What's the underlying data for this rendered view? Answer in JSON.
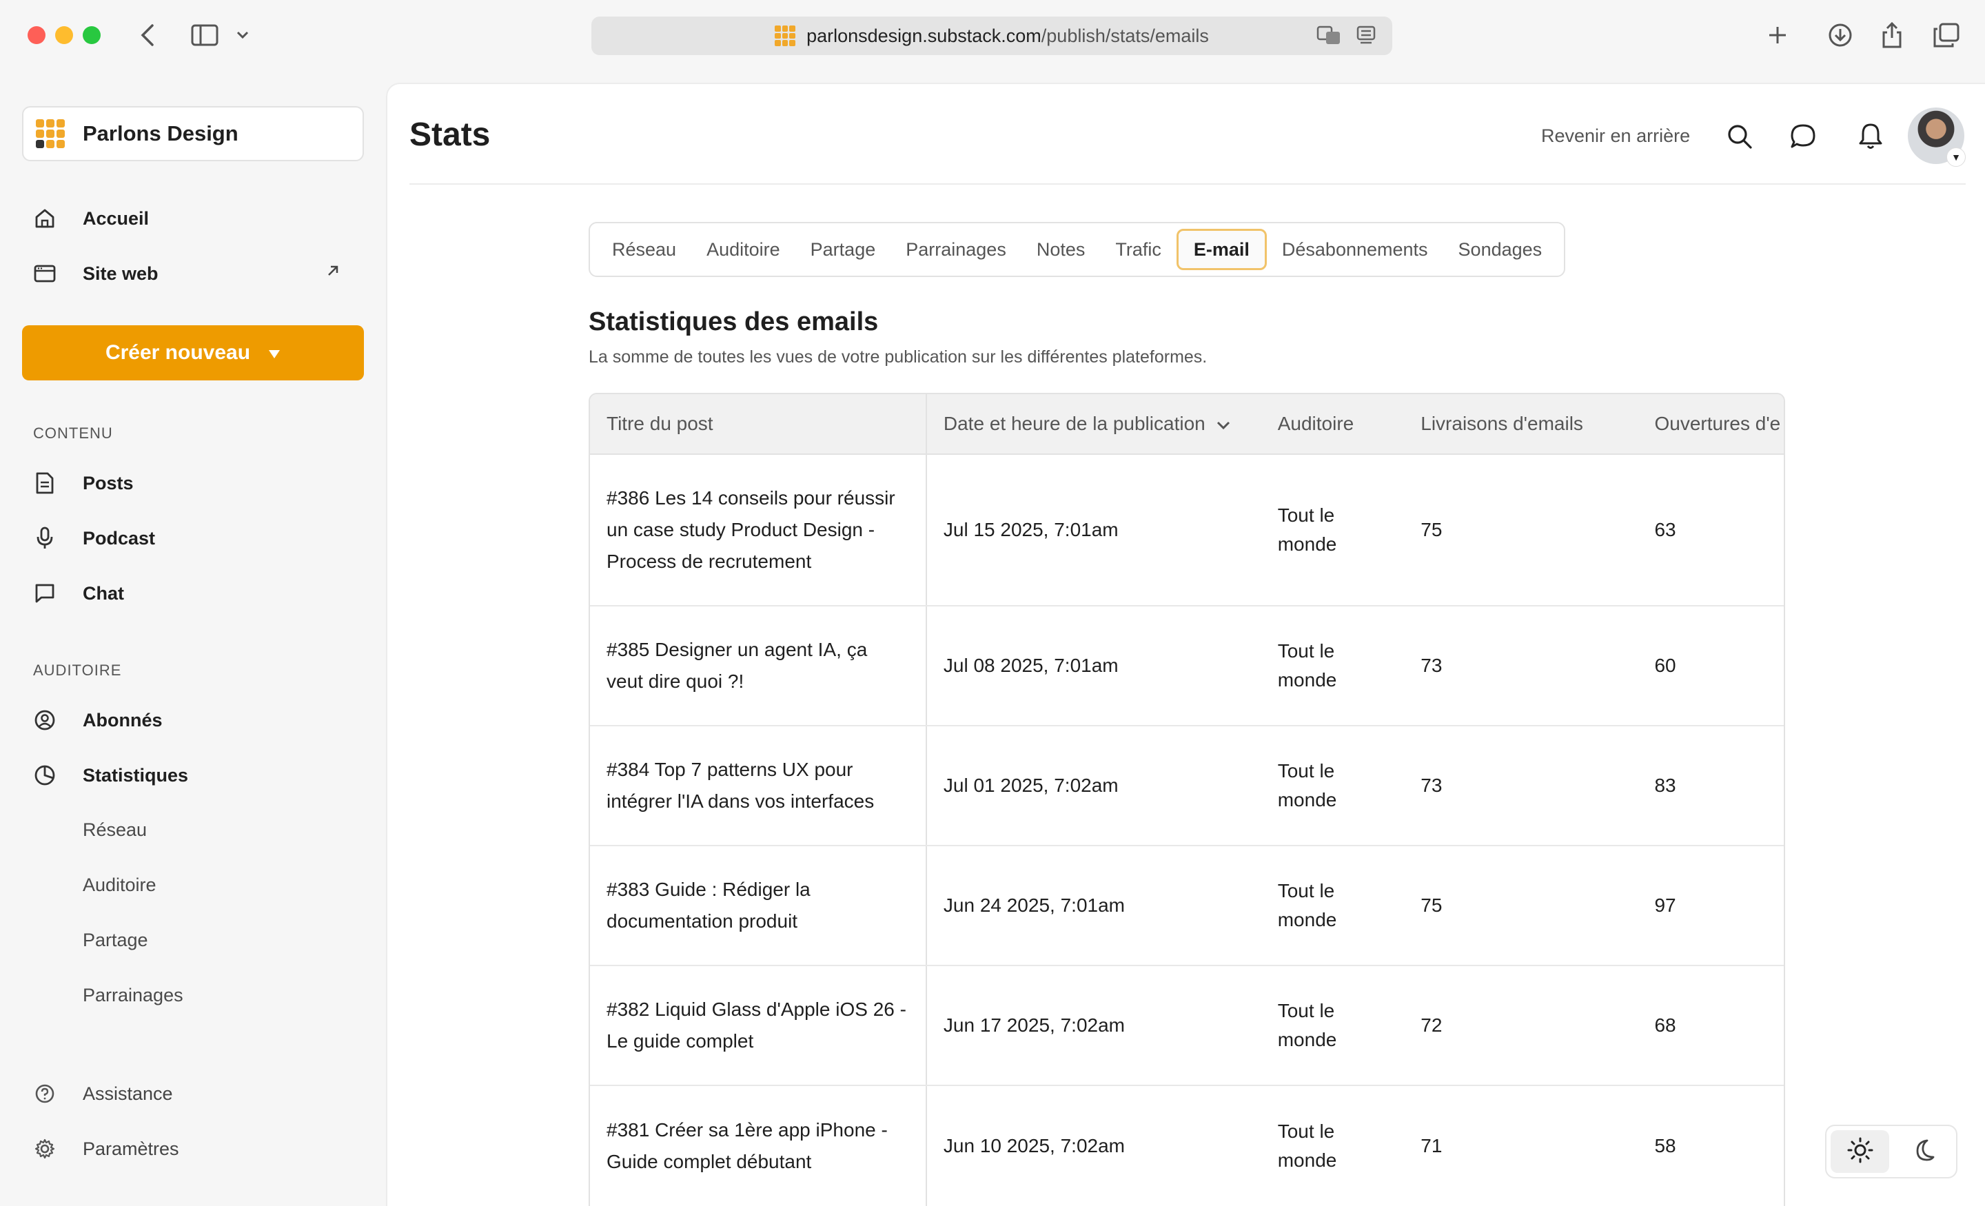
{
  "browser": {
    "url_domain": "parlonsdesign.substack.com",
    "url_path": "/publish/stats/emails"
  },
  "sidebar": {
    "publication_name": "Parlons Design",
    "top_items": [
      {
        "label": "Accueil",
        "icon": "home-icon"
      },
      {
        "label": "Site web",
        "icon": "browser-window-icon"
      }
    ],
    "create_label": "Créer nouveau",
    "content_label": "CONTENU",
    "content_items": [
      {
        "label": "Posts",
        "icon": "document-icon"
      },
      {
        "label": "Podcast",
        "icon": "microphone-icon"
      },
      {
        "label": "Chat",
        "icon": "chat-bubble-icon"
      }
    ],
    "audience_label": "AUDITOIRE",
    "audience_items": [
      {
        "label": "Abonnés",
        "icon": "user-circle-icon"
      },
      {
        "label": "Statistiques",
        "icon": "pie-chart-icon"
      }
    ],
    "stats_subitems": [
      "Réseau",
      "Auditoire",
      "Partage",
      "Parrainages"
    ],
    "bottom_items": [
      {
        "label": "Assistance",
        "icon": "help-icon"
      },
      {
        "label": "Paramètres",
        "icon": "gear-icon"
      }
    ]
  },
  "header": {
    "title": "Stats",
    "back_label": "Revenir en arrière"
  },
  "tabs": [
    "Réseau",
    "Auditoire",
    "Partage",
    "Parrainages",
    "Notes",
    "Trafic",
    "E-mail",
    "Désabonnements",
    "Sondages"
  ],
  "active_tab": "E-mail",
  "section": {
    "title": "Statistiques des emails",
    "subtitle": "La somme de toutes les vues de votre publication sur les différentes plateformes."
  },
  "table": {
    "columns": [
      "Titre du post",
      "Date et heure de la publication",
      "Auditoire",
      "Livraisons d'emails",
      "Ouvertures d'e"
    ],
    "rows": [
      {
        "title": [
          "#386 Les 14 conseils pour réussir",
          "un case study Product Design -",
          "Process de recrutement"
        ],
        "date": "Jul 15 2025, 7:01am",
        "audience": [
          "Tout le",
          "monde"
        ],
        "deliveries": "75",
        "opens": "63"
      },
      {
        "title": [
          "#385 Designer un agent IA, ça",
          "veut dire quoi ?!"
        ],
        "date": "Jul 08 2025, 7:01am",
        "audience": [
          "Tout le",
          "monde"
        ],
        "deliveries": "73",
        "opens": "60"
      },
      {
        "title": [
          "#384 Top 7 patterns UX pour",
          "intégrer l'IA dans vos interfaces"
        ],
        "date": "Jul 01 2025, 7:02am",
        "audience": [
          "Tout le",
          "monde"
        ],
        "deliveries": "73",
        "opens": "83"
      },
      {
        "title": [
          "#383 Guide : Rédiger la",
          "documentation produit"
        ],
        "date": "Jun 24 2025, 7:01am",
        "audience": [
          "Tout le",
          "monde"
        ],
        "deliveries": "75",
        "opens": "97"
      },
      {
        "title": [
          "#382 Liquid Glass d'Apple iOS 26 -",
          "Le guide complet"
        ],
        "date": "Jun 17 2025, 7:02am",
        "audience": [
          "Tout le",
          "monde"
        ],
        "deliveries": "72",
        "opens": "68"
      },
      {
        "title": [
          "#381 Créer sa 1ère app iPhone -",
          "Guide complet débutant"
        ],
        "date": "Jun 10 2025, 7:02am",
        "audience": [
          "Tout le",
          "monde"
        ],
        "deliveries": "71",
        "opens": "58"
      }
    ]
  }
}
